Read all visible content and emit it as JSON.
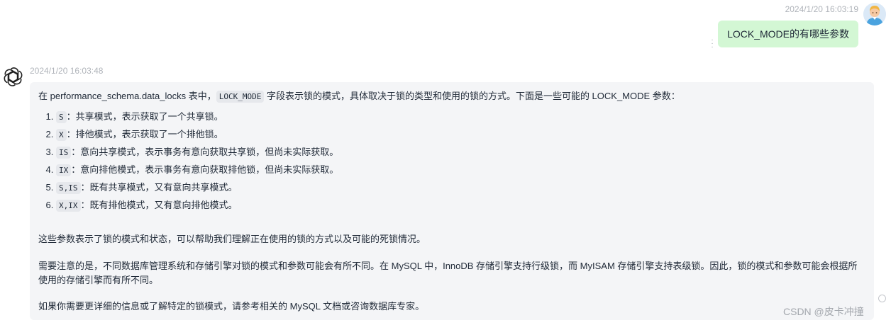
{
  "user_message": {
    "timestamp": "2024/1/20 16:03:19",
    "text": "LOCK_MODE的有哪些参数",
    "avatar_icon": "user-avatar-icon",
    "bubble_color": "#d3f7d4"
  },
  "assistant_message": {
    "timestamp": "2024/1/20 16:03:48",
    "icon": "openai-logo-icon",
    "intro": {
      "before": "在 performance_schema.data_locks 表中，",
      "code": "LOCK_MODE",
      "after": " 字段表示锁的模式，具体取决于锁的类型和使用的锁的方式。下面是一些可能的 LOCK_MODE 参数："
    },
    "modes": [
      {
        "code": "S",
        "desc": "：共享模式，表示获取了一个共享锁。"
      },
      {
        "code": "X",
        "desc": "：排他模式，表示获取了一个排他锁。"
      },
      {
        "code": "IS",
        "desc": "：意向共享模式，表示事务有意向获取共享锁，但尚未实际获取。"
      },
      {
        "code": "IX",
        "desc": "：意向排他模式，表示事务有意向获取排他锁，但尚未实际获取。"
      },
      {
        "code": "S,IS",
        "desc": "：既有共享模式，又有意向共享模式。"
      },
      {
        "code": "X,IX",
        "desc": "：既有排他模式，又有意向排他模式。"
      }
    ],
    "paragraph_1": "这些参数表示了锁的模式和状态，可以帮助我们理解正在使用的锁的方式以及可能的死锁情况。",
    "paragraph_2": "需要注意的是，不同数据库管理系统和存储引擎对锁的模式和参数可能会有所不同。在 MySQL 中，InnoDB 存储引擎支持行级锁，而 MyISAM 存储引擎支持表级锁。因此，锁的模式和参数可能会根据所使用的存储引擎而有所不同。",
    "paragraph_3": "如果你需要更详细的信息或了解特定的锁模式，请参考相关的 MySQL 文档或咨询数据库专家。",
    "bubble_color": "#f4f5f7"
  },
  "watermark": "CSDN @皮卡冲撞"
}
